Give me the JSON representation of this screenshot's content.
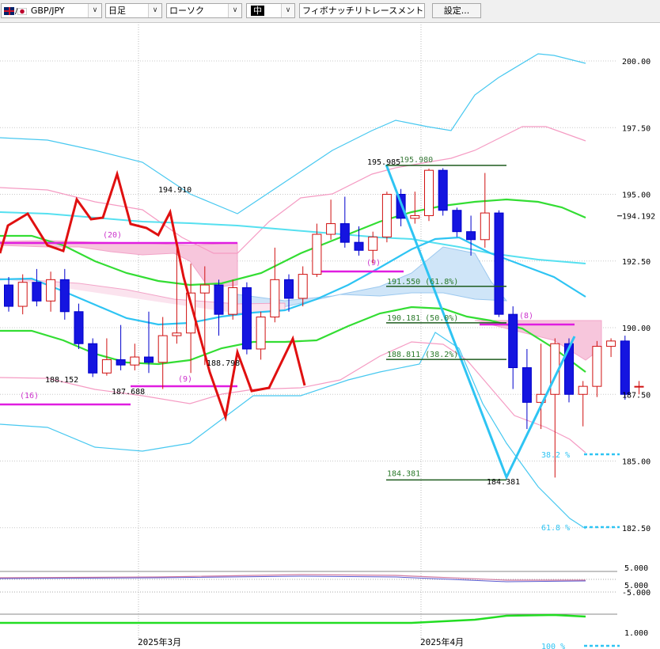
{
  "toolbar": {
    "symbol": "GBP/JPY",
    "timeframe": "日足",
    "chart_style": "ローソク",
    "line_weight": "中",
    "indicator": "フィボナッチリトレースメント",
    "settings_label": "設定..."
  },
  "chart_data": {
    "type": "candlestick",
    "symbol": "GBP/JPY",
    "timeframe": "日足",
    "y_axis": {
      "ticks": [
        "200.00",
        "197.50",
        "195.00",
        "192.50",
        "190.00",
        "187.50",
        "185.00",
        "182.50"
      ],
      "ylim": [
        181.5,
        201.3
      ],
      "current_price": "194.192",
      "grid": true
    },
    "x_axis": {
      "ticks": [
        "2025年3月",
        "2025年4月"
      ]
    },
    "candles": [
      [
        191.6,
        190.8,
        191.9,
        190.6
      ],
      [
        190.8,
        191.7,
        192.0,
        190.5
      ],
      [
        191.7,
        191.0,
        192.2,
        190.8
      ],
      [
        191.0,
        191.8,
        192.1,
        190.6
      ],
      [
        191.8,
        190.6,
        192.2,
        190.3
      ],
      [
        190.6,
        189.4,
        190.9,
        189.2
      ],
      [
        189.4,
        188.3,
        189.6,
        188.15
      ],
      [
        188.3,
        188.8,
        189.6,
        188.2
      ],
      [
        188.8,
        188.6,
        190.1,
        188.4
      ],
      [
        188.6,
        188.9,
        189.4,
        188.4
      ],
      [
        188.9,
        188.7,
        190.6,
        188.3
      ],
      [
        188.7,
        189.7,
        190.4,
        187.7
      ],
      [
        189.7,
        189.8,
        193.0,
        189.4
      ],
      [
        189.8,
        191.3,
        192.4,
        188.3
      ],
      [
        191.3,
        191.6,
        192.3,
        188.6
      ],
      [
        191.6,
        190.5,
        191.8,
        189.7
      ],
      [
        190.5,
        191.5,
        191.8,
        190.3
      ],
      [
        191.5,
        189.2,
        191.7,
        189.0
      ],
      [
        189.2,
        190.4,
        190.6,
        188.8
      ],
      [
        190.4,
        191.8,
        193.0,
        190.2
      ],
      [
        191.8,
        191.1,
        192.0,
        190.6
      ],
      [
        191.1,
        192.0,
        192.3,
        190.8
      ],
      [
        192.0,
        193.5,
        193.9,
        191.9
      ],
      [
        193.5,
        193.9,
        194.8,
        193.3
      ],
      [
        193.9,
        193.2,
        194.91,
        193.0
      ],
      [
        193.2,
        192.9,
        193.8,
        192.7
      ],
      [
        192.9,
        193.4,
        193.6,
        192.4
      ],
      [
        193.4,
        195.0,
        195.1,
        193.2
      ],
      [
        195.0,
        194.1,
        195.2,
        193.8
      ],
      [
        194.1,
        194.2,
        195.1,
        193.9
      ],
      [
        194.2,
        195.9,
        195.96,
        194.0
      ],
      [
        195.9,
        194.4,
        195.98,
        194.2
      ],
      [
        194.4,
        193.6,
        194.5,
        193.4
      ],
      [
        193.6,
        193.3,
        194.2,
        192.7
      ],
      [
        193.3,
        194.3,
        195.8,
        193.0
      ],
      [
        194.3,
        190.5,
        194.4,
        190.4
      ],
      [
        190.5,
        188.5,
        190.8,
        187.7
      ],
      [
        188.5,
        187.2,
        189.2,
        186.2
      ],
      [
        187.2,
        187.5,
        189.4,
        186.2
      ],
      [
        187.5,
        189.4,
        189.6,
        184.381
      ],
      [
        189.4,
        187.5,
        189.6,
        187.2
      ],
      [
        187.5,
        187.8,
        188.0,
        186.3
      ],
      [
        187.8,
        189.3,
        189.5,
        187.4
      ],
      [
        189.3,
        189.5,
        189.6,
        188.9
      ],
      [
        189.5,
        187.5,
        189.7,
        187.3
      ],
      [
        187.8,
        187.8,
        188.0,
        187.5
      ]
    ],
    "price_labels": [
      "195.985",
      "195.980",
      "194.910",
      "188.152",
      "187.688",
      "188.798",
      "184.381"
    ],
    "fibonacci": {
      "high_label": "195.980",
      "levels": [
        {
          "label": "191.550 (61.8%)",
          "value": 191.55
        },
        {
          "label": "190.181 (50.0%)",
          "value": 190.181
        },
        {
          "label": "188.811 (38.2%)",
          "value": 188.811
        }
      ],
      "low_label": "184.381",
      "ext_labels": [
        "38.2 %",
        "61.8 %",
        "100 %"
      ]
    },
    "period_labels": [
      "(20)",
      "(16)",
      "(9)",
      "(9)",
      "(8)"
    ],
    "sub_panel_ticks": [
      "5.000",
      "-5.000",
      "1.000"
    ]
  }
}
